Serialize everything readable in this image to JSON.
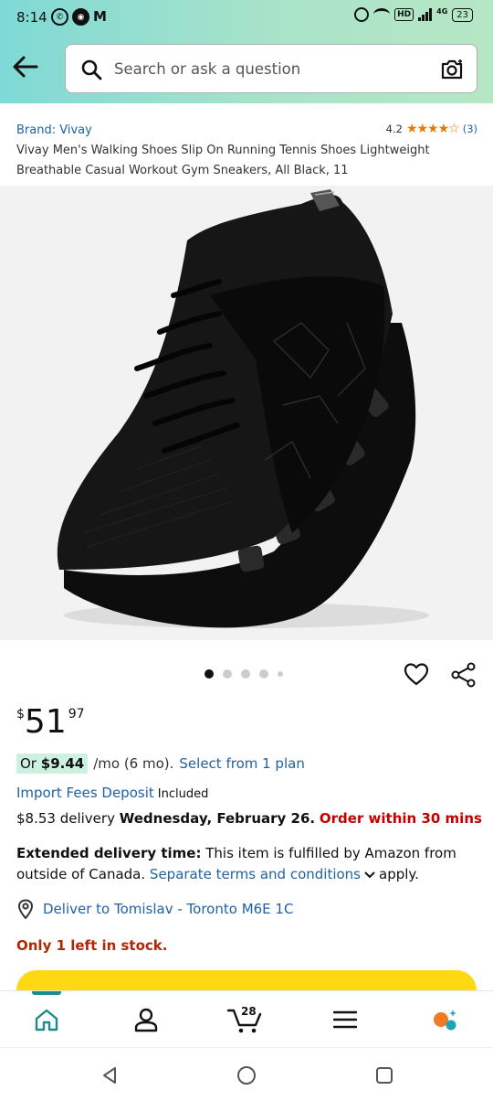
{
  "status_bar": {
    "time": "8:14",
    "network": "4G",
    "battery": "23"
  },
  "search": {
    "placeholder": "Search or ask a question"
  },
  "product": {
    "brand": "Brand: Vivay",
    "rating_value": "4.2",
    "rating_stars": 4.2,
    "rating_count": "(3)",
    "title": "Vivay Men's Walking Shoes Slip On Running Tennis Shoes Lightweight Breathable Casual Workout Gym Sneakers, All Black, 11",
    "image_count": 5,
    "active_image": 1
  },
  "price": {
    "symbol": "$",
    "whole": "51",
    "fraction": "97"
  },
  "monthly": {
    "or_label": "Or",
    "amount": "$9.44",
    "term": "/mo (6 mo).",
    "link": "Select from 1 plan"
  },
  "import_fees": {
    "link": "Import Fees Deposit",
    "status": "Included"
  },
  "delivery": {
    "cost": "$8.53 delivery",
    "date": "Wednesday, February 26.",
    "urgency": "Order within 30 mins"
  },
  "extended": {
    "label": "Extended delivery time:",
    "text": "This item is fulfilled by Amazon from outside of Canada.",
    "link": "Separate terms and conditions",
    "suffix": "apply."
  },
  "deliver_to": {
    "text": "Deliver to Tomislav - Toronto M6E 1C"
  },
  "stock": {
    "text": "Only 1 left in stock."
  },
  "nav": {
    "cart_count": "28"
  },
  "colors": {
    "link": "#2162a1",
    "teal_accent": "#1d8b8b",
    "stars": "#e67a00",
    "buy_button": "#ffd814",
    "urgent": "#c40000"
  }
}
